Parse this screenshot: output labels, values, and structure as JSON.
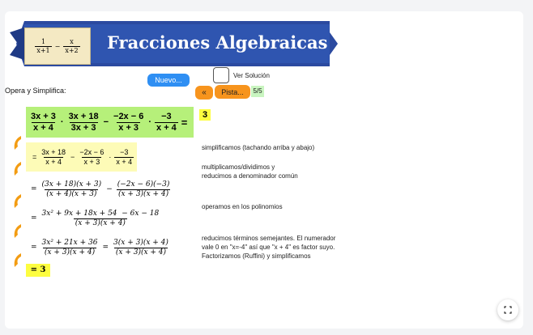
{
  "header": {
    "title": "Fracciones Algebraicas",
    "logo_num_left": "1",
    "logo_den_left": "x+1",
    "logo_minus": "−",
    "logo_num_right": "x",
    "logo_den_right": "x+2"
  },
  "controls": {
    "instruction": "Opera y Simplifica:",
    "nuevo_label": "Nuevo...",
    "ver_solucion_label": "Ver Solución",
    "back_label": "«",
    "pista_label": "Pista...",
    "counter": "5/5"
  },
  "problem": {
    "f1_num": "3x + 3",
    "f1_den": "x + 4",
    "f2_num": "3x + 18",
    "f2_den": "3x + 3",
    "f3_num": "−2x − 6",
    "f3_den": "x + 3",
    "f4_num": "−3",
    "f4_den": "x + 4",
    "dot": "·",
    "minus": "−",
    "eq": "=",
    "answer": "3"
  },
  "steps": [
    {
      "f1_num": "3x + 18",
      "f1_den": "x + 4",
      "f2_num": "−2x − 6",
      "f2_den": "x + 3",
      "f3_num": "−3",
      "f3_den": "x + 4",
      "note": "simplificamos (tachando arriba y abajo)"
    },
    {
      "f1_num": "(3x + 18)(x + 3)",
      "f1_den": "(x + 4)(x + 3)",
      "f2_num": "(−2x − 6)(−3)",
      "f2_den": "(x + 3)(x + 4)",
      "note_line1": "multiplicamos/dividimos y",
      "note_line2": "reducimos a denominador común"
    },
    {
      "num": "3x² + 9x + 18x + 54  − 6x − 18",
      "den": "(x + 3)(x + 4)",
      "note": "operamos en los polinomios"
    },
    {
      "f1_num": "3x² + 21x + 36",
      "f1_den": "(x + 3)(x + 4)",
      "f2_num": "3(x + 3)(x + 4)",
      "f2_den": "(x + 3)(x + 4)",
      "note_line1": "reducimos términos semejantes. El numerador",
      "note_line2": "vale 0 en \"x=-4\" así que \"x + 4\" es factor suyo.",
      "note_line3": "Factorizamos (Ruffini) y simplificamos"
    }
  ],
  "final": {
    "result": "= 3"
  },
  "colors": {
    "highlight_green": "#b6f07a",
    "highlight_yellow": "#fdfd8a",
    "step_bg": "#fdfbb7",
    "nuevo": "#2f8ff3",
    "pista": "#f7941d",
    "arrow": "#f39c12",
    "banner": "#2b4aa0"
  },
  "icons": {
    "fullscreen": "fullscreen-icon"
  }
}
